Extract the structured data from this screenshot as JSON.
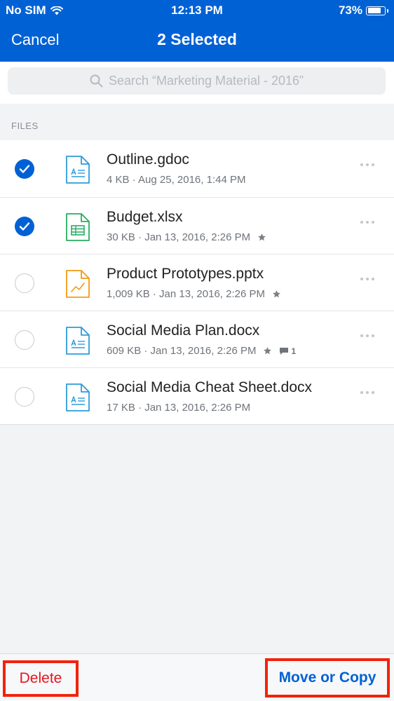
{
  "status_bar": {
    "carrier": "No SIM",
    "time": "12:13 PM",
    "battery": "73%"
  },
  "nav": {
    "cancel_label": "Cancel",
    "title": "2 Selected"
  },
  "search": {
    "placeholder": "Search “Marketing Material - 2016”"
  },
  "section_label": "FILES",
  "files": [
    {
      "name": "Outline.gdoc",
      "meta": "4 KB · Aug 25, 2016, 1:44 PM",
      "selected": true,
      "type": "doc",
      "starred": false,
      "comments": ""
    },
    {
      "name": "Budget.xlsx",
      "meta": "30 KB · Jan 13, 2016, 2:26 PM",
      "selected": true,
      "type": "sheet",
      "starred": true,
      "comments": ""
    },
    {
      "name": "Product Prototypes.pptx",
      "meta": "1,009 KB · Jan 13, 2016, 2:26 PM",
      "selected": false,
      "type": "slides",
      "starred": true,
      "comments": ""
    },
    {
      "name": "Social Media Plan.docx",
      "meta": "609 KB · Jan 13, 2016, 2:26 PM",
      "selected": false,
      "type": "doc",
      "starred": true,
      "comments": "1"
    },
    {
      "name": "Social Media Cheat Sheet.docx",
      "meta": "17 KB · Jan 13, 2016, 2:26 PM",
      "selected": false,
      "type": "doc",
      "starred": false,
      "comments": ""
    }
  ],
  "toolbar": {
    "delete_label": "Delete",
    "move_copy_label": "Move or Copy"
  },
  "colors": {
    "brand": "#0061d5",
    "delete": "#e8141d",
    "highlight_border": "#f4220c",
    "doc_icon": "#2d9cdb",
    "sheet_icon": "#27ae60",
    "slides_icon": "#f39c12"
  }
}
